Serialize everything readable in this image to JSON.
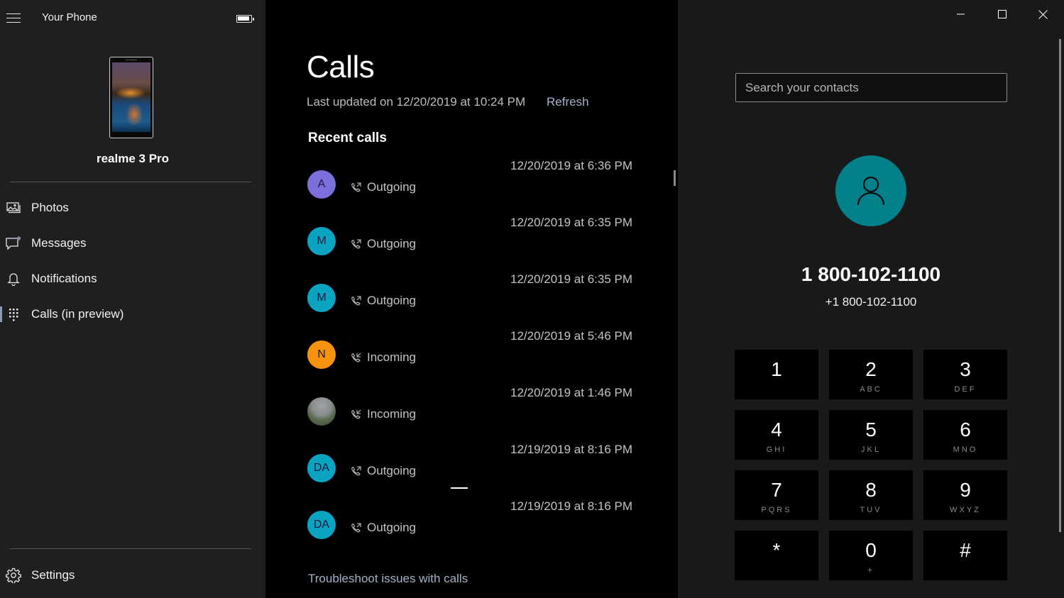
{
  "app": {
    "title": "Your Phone",
    "battery_icon": "battery-full-icon",
    "menu_icon": "hamburger-menu-icon"
  },
  "device": {
    "name": "realme 3 Pro"
  },
  "sidebar": {
    "items": [
      {
        "label": "Photos",
        "icon": "photos-icon",
        "active": false
      },
      {
        "label": "Messages",
        "icon": "message-icon",
        "active": false,
        "badge": true
      },
      {
        "label": "Notifications",
        "icon": "bell-icon",
        "active": false
      },
      {
        "label": "Calls (in preview)",
        "icon": "dialpad-icon",
        "active": true
      }
    ],
    "settings": {
      "label": "Settings",
      "icon": "gear-icon"
    }
  },
  "calls": {
    "title": "Calls",
    "last_updated": "Last updated on 12/20/2019 at 10:24 PM",
    "refresh_label": "Refresh",
    "recent_header": "Recent calls",
    "items": [
      {
        "initials": "A",
        "color": "#7b6fdc",
        "type": "Outgoing",
        "time": "12/20/2019 at 6:36 PM"
      },
      {
        "initials": "M",
        "color": "#0aa3c2",
        "type": "Outgoing",
        "time": "12/20/2019 at 6:35 PM"
      },
      {
        "initials": "M",
        "color": "#0aa3c2",
        "type": "Outgoing",
        "time": "12/20/2019 at 6:35 PM"
      },
      {
        "initials": "N",
        "color": "#f7930e",
        "type": "Incoming",
        "time": "12/20/2019 at 5:46 PM"
      },
      {
        "initials": "",
        "color": "photo",
        "type": "Incoming",
        "time": "12/20/2019 at 1:46 PM"
      },
      {
        "initials": "DA",
        "color": "#0aa3c2",
        "type": "Outgoing",
        "time": "12/19/2019 at 8:16 PM"
      },
      {
        "initials": "DA",
        "color": "#0aa3c2",
        "type": "Outgoing",
        "time": "12/19/2019 at 8:16 PM"
      }
    ],
    "troubleshoot_label": "Troubleshoot issues with calls"
  },
  "dialer": {
    "search_placeholder": "Search your contacts",
    "search_value": "",
    "contact_avatar_color": "#03818a",
    "number_display": "1 800-102-1100",
    "number_formatted": "+1 800-102-1100",
    "keys": [
      {
        "digit": "1",
        "letters": ""
      },
      {
        "digit": "2",
        "letters": "ABC"
      },
      {
        "digit": "3",
        "letters": "DEF"
      },
      {
        "digit": "4",
        "letters": "GHI"
      },
      {
        "digit": "5",
        "letters": "JKL"
      },
      {
        "digit": "6",
        "letters": "MNO"
      },
      {
        "digit": "7",
        "letters": "PQRS"
      },
      {
        "digit": "8",
        "letters": "TUV"
      },
      {
        "digit": "9",
        "letters": "WXYZ"
      },
      {
        "digit": "*",
        "letters": ""
      },
      {
        "digit": "0",
        "letters": "+"
      },
      {
        "digit": "#",
        "letters": ""
      }
    ]
  },
  "window_controls": {
    "minimize_icon": "minimize-icon",
    "maximize_icon": "maximize-icon",
    "close_icon": "close-icon"
  }
}
